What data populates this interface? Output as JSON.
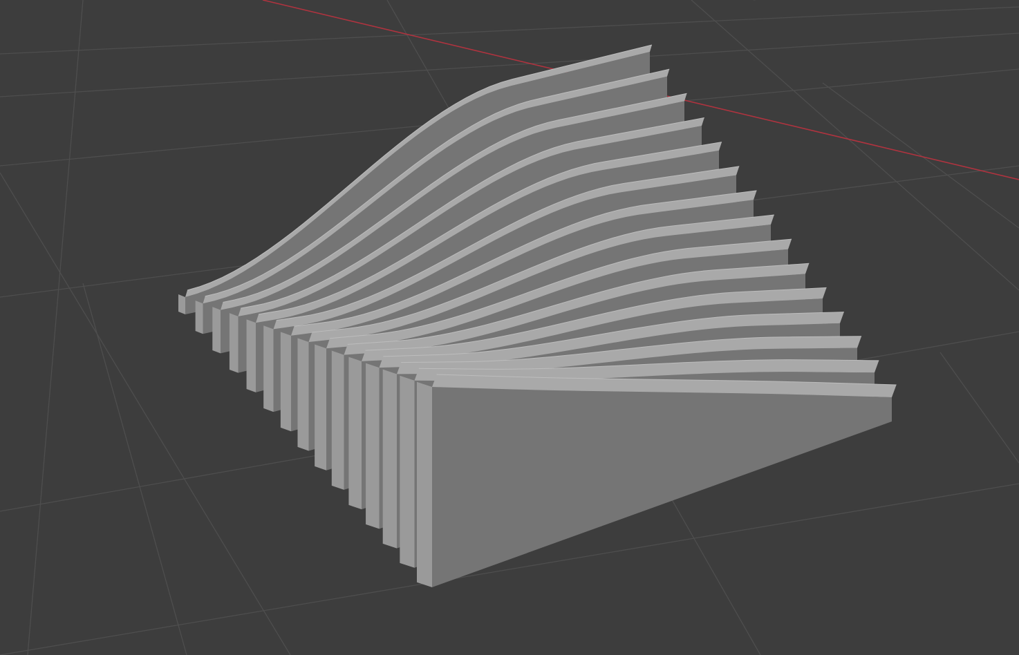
{
  "viewport": {
    "background": "#3d3d3d",
    "grid_color": "#4e4e4e",
    "x_axis_color": "#b0333f",
    "mesh_colors": {
      "front_face": "#757575",
      "top_face": "#a9a9a9",
      "side_face": "#9a9a9a",
      "top_edge_highlight": "#bdbdbd"
    }
  },
  "object": {
    "semantic": "parametric-ribs-mesh",
    "fin_count": 15
  }
}
